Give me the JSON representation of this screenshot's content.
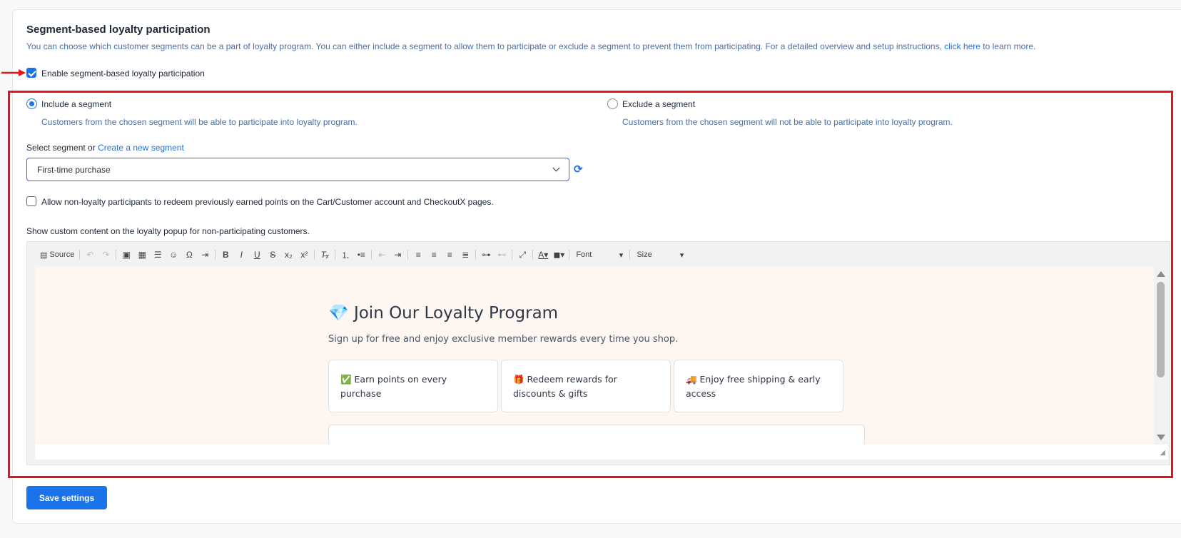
{
  "section": {
    "title": "Segment-based loyalty participation",
    "description_pre": "You can choose which customer segments can be a part of loyalty program. You can either include a segment to allow them to participate or exclude a segment to prevent them from participating. For a detailed overview and setup instructions, ",
    "description_link": "click here",
    "description_post": " to learn more."
  },
  "enable": {
    "label": "Enable segment-based loyalty participation",
    "checked": true
  },
  "include": {
    "label": "Include a segment",
    "help": "Customers from the chosen segment will be able to participate into loyalty program.",
    "selected": true
  },
  "exclude": {
    "label": "Exclude a segment",
    "help": "Customers from the chosen segment will not be able to participate into loyalty program.",
    "selected": false
  },
  "segment": {
    "label": "Select segment or ",
    "create_link": "Create a new segment",
    "value": "First-time purchase"
  },
  "allow_redeem": {
    "label": "Allow non-loyalty participants to redeem previously earned points on the Cart/Customer account and CheckoutX pages.",
    "checked": false
  },
  "custom_content": {
    "label": "Show custom content on the loyalty popup for non-participating customers."
  },
  "toolbar": {
    "source": "Source",
    "font": "Font",
    "size": "Size"
  },
  "promo": {
    "title": "💎 Join Our Loyalty Program",
    "subtitle": "Sign up for free and enjoy exclusive member rewards every time you shop.",
    "benefits": [
      "✅ Earn points on every purchase",
      "🎁 Redeem rewards for discounts & gifts",
      "🚚 Enjoy free shipping & early access"
    ]
  },
  "save_button": "Save settings",
  "colors": {
    "accent": "#1a73e8",
    "highlight": "#e8141c",
    "editor_bg": "#fef6f0"
  }
}
